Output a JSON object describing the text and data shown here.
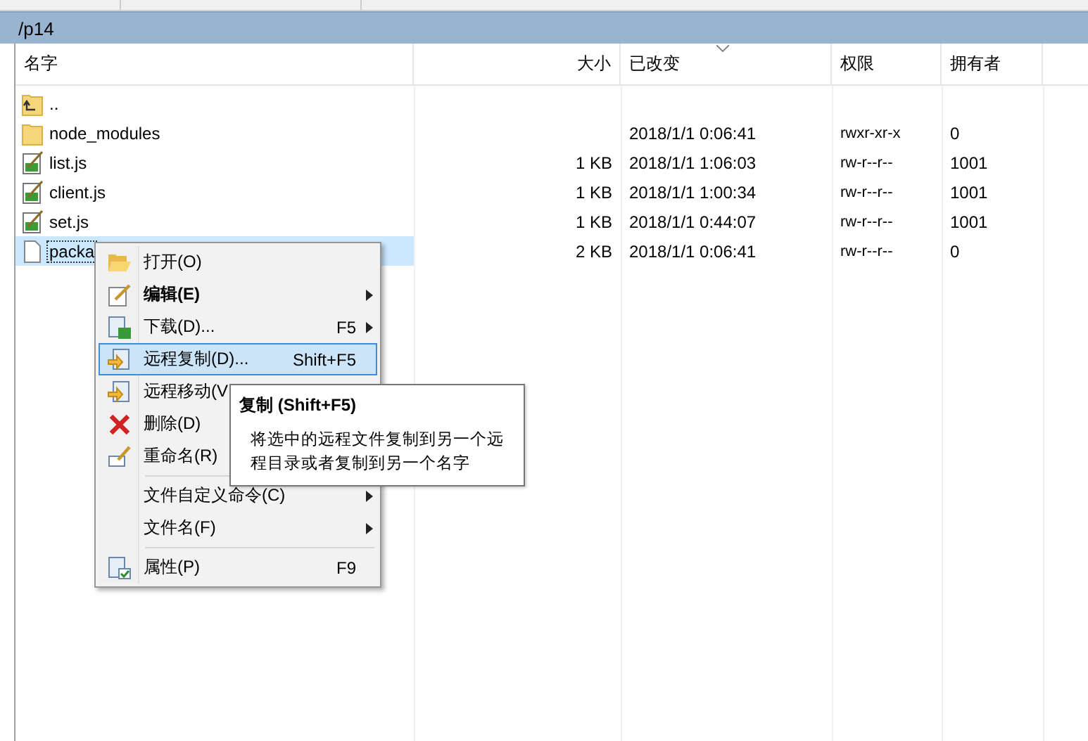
{
  "path_bar": {
    "path": "/p14"
  },
  "table": {
    "columns": [
      {
        "label": "名字",
        "sorted": false
      },
      {
        "label": "大小",
        "sorted": false
      },
      {
        "label": "已改变",
        "sorted": true
      },
      {
        "label": "权限",
        "sorted": false
      },
      {
        "label": "拥有者",
        "sorted": false
      }
    ],
    "rows": [
      {
        "kind": "parent",
        "name": "..",
        "selected": false
      },
      {
        "kind": "folder",
        "name": "node_modules",
        "modified": "2018/1/1 0:06:41",
        "permissions": "rwxr-xr-x",
        "owner": "0",
        "selected": false
      },
      {
        "kind": "script",
        "name": "list.js",
        "size": "1 KB",
        "modified": "2018/1/1 1:06:03",
        "permissions": "rw-r--r--",
        "owner": "1001",
        "selected": false
      },
      {
        "kind": "script",
        "name": "client.js",
        "size": "1 KB",
        "modified": "2018/1/1 1:00:34",
        "permissions": "rw-r--r--",
        "owner": "1001",
        "selected": false
      },
      {
        "kind": "script",
        "name": "set.js",
        "size": "1 KB",
        "modified": "2018/1/1 0:44:07",
        "permissions": "rw-r--r--",
        "owner": "1001",
        "selected": false
      },
      {
        "kind": "file",
        "name": "packa",
        "size": "2 KB",
        "modified": "2018/1/1 0:06:41",
        "permissions": "rw-r--r--",
        "owner": "0",
        "selected": true
      }
    ]
  },
  "context_menu": {
    "items": [
      {
        "kind": "item",
        "label": "打开(O)",
        "submenu": false,
        "bold": false,
        "selected": false
      },
      {
        "kind": "item",
        "label": "编辑(E)",
        "submenu": true,
        "bold": true,
        "selected": false
      },
      {
        "kind": "item",
        "label": "下载(D)...",
        "shortcut": "F5",
        "submenu": true,
        "bold": false,
        "selected": false
      },
      {
        "kind": "item",
        "label": "远程复制(D)...",
        "shortcut": "Shift+F5",
        "submenu": false,
        "bold": false,
        "selected": true
      },
      {
        "kind": "item",
        "label": "远程移动(V",
        "bold": false,
        "selected": false
      },
      {
        "kind": "item",
        "label": "删除(D)",
        "bold": false,
        "selected": false
      },
      {
        "kind": "item",
        "label": "重命名(R)",
        "bold": false,
        "selected": false
      },
      {
        "kind": "separator"
      },
      {
        "kind": "item",
        "label": "文件自定义命令(C)",
        "submenu": true,
        "bold": false,
        "selected": false
      },
      {
        "kind": "item",
        "label": "文件名(F)",
        "submenu": true,
        "bold": false,
        "selected": false
      },
      {
        "kind": "separator"
      },
      {
        "kind": "item",
        "label": "属性(P)",
        "shortcut": "F9",
        "submenu": false,
        "bold": false,
        "selected": false
      }
    ]
  },
  "tooltip": {
    "title": "复制 (Shift+F5)",
    "text": "将选中的远程文件复制到另一个远程目录或者复制到另一个名字"
  }
}
